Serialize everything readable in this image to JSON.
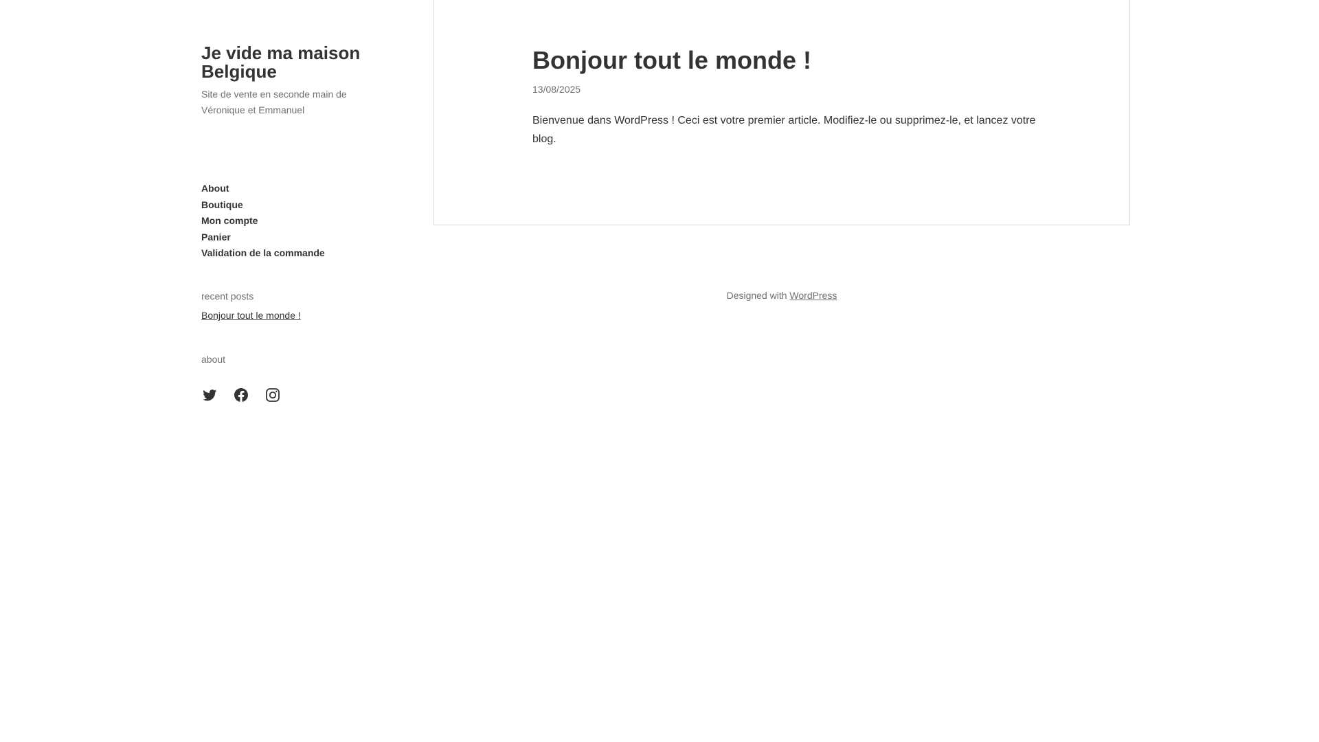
{
  "site": {
    "title": "Je vide ma maison Belgique",
    "description": "Site de vente en seconde main de Véronique et Emmanuel"
  },
  "nav": {
    "items": [
      {
        "label": "About"
      },
      {
        "label": "Boutique"
      },
      {
        "label": "Mon compte"
      },
      {
        "label": "Panier"
      },
      {
        "label": "Validation de la commande"
      }
    ]
  },
  "widgets": {
    "recent_posts": {
      "title": "recent posts",
      "items": [
        {
          "label": "Bonjour tout le monde !"
        }
      ]
    },
    "about": {
      "title": "about"
    }
  },
  "social": {
    "icons": [
      "twitter-icon",
      "facebook-icon",
      "instagram-icon"
    ]
  },
  "post": {
    "title": "Bonjour tout le monde !",
    "date": "13/08/2025",
    "content": "Bienvenue dans WordPress ! Ceci est votre premier article. Modifiez-le ou supprimez-le, et lancez votre blog."
  },
  "footer": {
    "prefix": "Designed with",
    "link_label": "WordPress"
  },
  "colors": {
    "text": "#333333",
    "muted": "#707070",
    "border": "#dcdcdc",
    "background": "#ffffff"
  }
}
